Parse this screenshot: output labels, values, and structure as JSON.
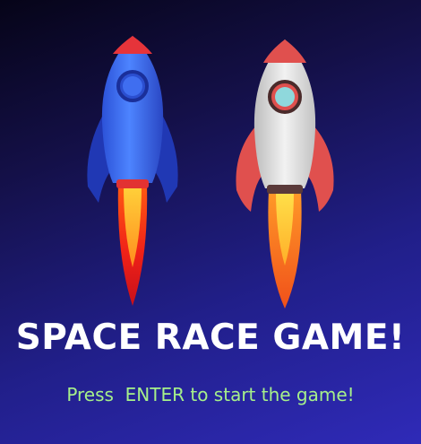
{
  "game": {
    "title": "SPACE RACE GAME!",
    "start_prompt": "Press  ENTER to start the game!"
  },
  "rockets": [
    {
      "name": "blue-rocket",
      "body_color": "#3a6cf0",
      "fin_color": "#2442c8",
      "nose_color": "#e6343a"
    },
    {
      "name": "white-rocket",
      "body_color": "#dcdcdc",
      "fin_color": "#e0504e",
      "nose_color": "#e0504e"
    }
  ],
  "colors": {
    "title": "#ffffff",
    "prompt": "#a6f08a",
    "background_top": "#060418",
    "background_bottom": "#2f2ab8"
  }
}
